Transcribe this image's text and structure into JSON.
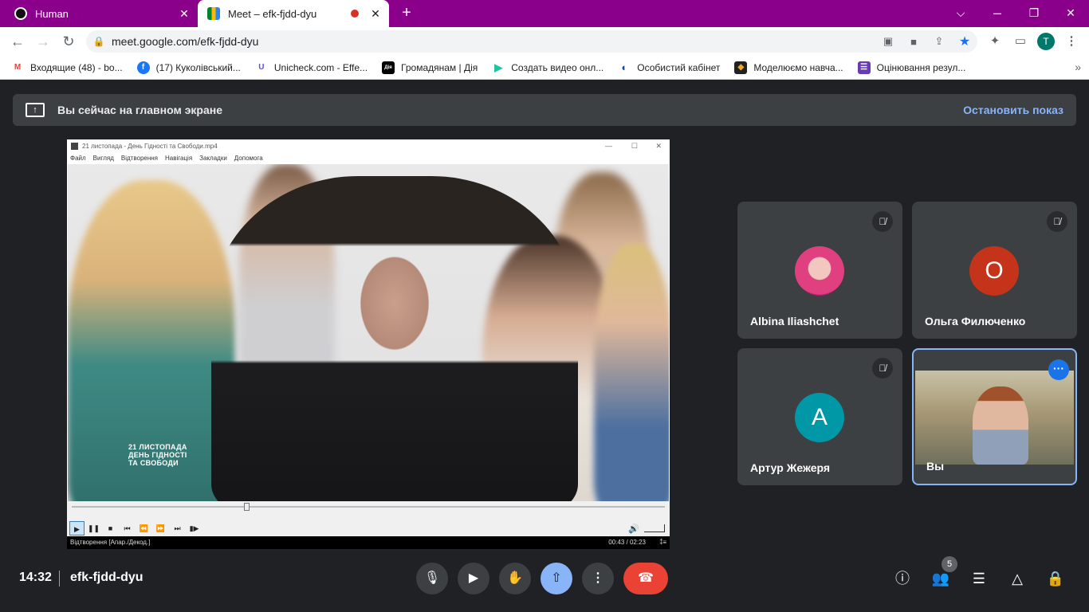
{
  "browser": {
    "tabs": [
      {
        "title": "Human",
        "close": "✕"
      },
      {
        "title": "Meet – efk-fjdd-dyu",
        "close": "✕"
      }
    ],
    "new_tab": "+",
    "window_controls": {
      "minimize": "⌵",
      "restore": "❐",
      "close": "✕"
    },
    "url": "meet.google.com/efk-fjdd-dyu",
    "profile_initial": "T",
    "bookmarks": [
      {
        "label": "Входящие (48) - bo...",
        "icon": "gmail-icon",
        "glyph": "M",
        "color": "#ea4335"
      },
      {
        "label": "(17) Куколівський...",
        "icon": "facebook-icon",
        "glyph": "f",
        "color": "#1877f2"
      },
      {
        "label": "Unicheck.com - Effe...",
        "icon": "unicheck-icon",
        "glyph": "U",
        "color": "#5b4fe0"
      },
      {
        "label": "Громадянам | Дія",
        "icon": "diia-icon",
        "glyph": "Дія",
        "color": "#000000"
      },
      {
        "label": "Создать видео онл...",
        "icon": "play-icon",
        "glyph": "▶",
        "color": "#1ec3a0"
      },
      {
        "label": "Особистий кабінет",
        "icon": "cabinet-icon",
        "glyph": "◐",
        "color": "#0d47a1"
      },
      {
        "label": "Моделюємо навча...",
        "icon": "model-icon",
        "glyph": "◆",
        "color": "#222222"
      },
      {
        "label": "Оцінювання резул...",
        "icon": "forms-icon",
        "glyph": "☰",
        "color": "#673ab7"
      }
    ],
    "bookmarks_more": "»"
  },
  "meet": {
    "presenting_banner": "Вы сейчас на главном экране",
    "stop_presenting": "Остановить показ",
    "meeting_time": "14:32",
    "meeting_code": "efk-fjdd-dyu",
    "participants_count": "5",
    "participants": [
      {
        "name": "Albina Iliashchet",
        "avatar_type": "photo",
        "muted": true
      },
      {
        "name": "Ольга Филюченко",
        "avatar_letter": "О",
        "avatar_color": "#c5331b",
        "muted": true
      },
      {
        "name": "Артур Жежеря",
        "avatar_letter": "А",
        "avatar_color": "#0097a7",
        "muted": true
      },
      {
        "name": "Вы",
        "avatar_type": "camera",
        "muted": false
      }
    ]
  },
  "player": {
    "window_title": "21 листопада - День Гідності та Свободи.mp4",
    "menu": [
      "Файл",
      "Вигляд",
      "Відтворення",
      "Навігація",
      "Закладки",
      "Допомога"
    ],
    "video_caption": [
      "21 ЛИСТОПАДА",
      "ДЕНЬ ГІДНОСТІ",
      "ТА СВОБОДИ"
    ],
    "progress": 0.295,
    "status": "Відтворення [Апар./Декод.]",
    "time": "00:43 / 02:23",
    "status_right": "⁑≡"
  }
}
